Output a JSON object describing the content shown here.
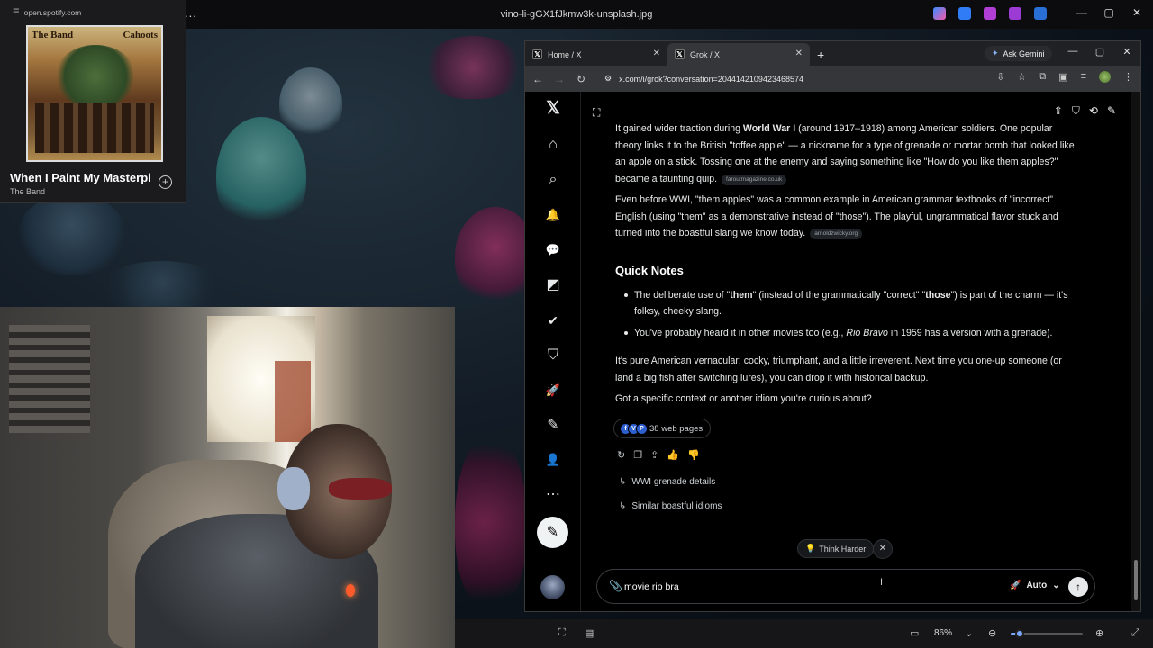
{
  "viewer": {
    "title": "vino-li-gGX1fJkmw3k-unsplash.jpg",
    "more_label": "...",
    "zoom_level": "86%",
    "zoom_slider_level_percent": 12
  },
  "spotify": {
    "url": "open.spotify.com",
    "album_cover_text_left": "The Band",
    "album_cover_text_right": "Cahoots",
    "track_title": "When I Paint My Masterpiece",
    "artist": "The Band",
    "add_label": "+"
  },
  "browser": {
    "tabs": [
      {
        "label": "Home / X",
        "active": false
      },
      {
        "label": "Grok / X",
        "active": true
      }
    ],
    "new_tab_label": "+",
    "ask_gemini_label": "Ask Gemini",
    "url": "x.com/i/grok?conversation=2044142109423468574"
  },
  "chat": {
    "para1": {
      "before": "It gained wider traction during ",
      "bold": "World War I",
      "after": " (around 1917–1918) among American soldiers. One popular theory links it to the British \"toffee apple\" — a nickname for a type of grenade or mortar bomb that looked like an apple on a stick. Tossing one at the enemy and saying something like \"How do you like them apples?\" became a taunting quip.",
      "source": "faroutmagazine.co.uk"
    },
    "para2": {
      "text": "Even before WWI, \"them apples\" was a common example in American grammar textbooks of \"incorrect\" English (using \"them\" as a demonstrative instead of \"those\"). The playful, ungrammatical flavor stuck and turned into the boastful slang we know today.",
      "source": "arnoldzwicky.org"
    },
    "heading": "Quick Notes",
    "bullet1": {
      "a": "The deliberate use of \"",
      "b1": "them",
      "c": "\" (instead of the grammatically \"correct\" \"",
      "b2": "those",
      "d": "\") is part of the charm — it's folksy, cheeky slang."
    },
    "bullet2": {
      "a": "You've probably heard it in other movies too (e.g., ",
      "italic": "Rio Bravo",
      "b": " in 1959 has a version with a grenade)."
    },
    "para3": "It's pure American vernacular: cocky, triumphant, and a little irreverent. Next time you one-up someone (or land a big fish after switching lures), you can drop it with historical backup.",
    "para4": "Got a specific context or another idiom you're curious about?",
    "web_pages_label": "38 web pages",
    "followups": [
      "WWI grenade details",
      "Similar boastful idioms"
    ],
    "think_harder_label": "Think Harder",
    "input_value": "movie rio bra",
    "mode_label": "Auto"
  },
  "icons": {
    "x_logo": "𝕏",
    "home": "⌂",
    "search": "⌕",
    "bell": "🔔",
    "message": "💬",
    "grok": "◩",
    "verified": "✔",
    "bookmark": "⛉",
    "rocket": "🚀",
    "edit": "✎",
    "profile": "👤",
    "more": "⋯",
    "compose": "✎"
  },
  "colors": {
    "x_background": "#000000",
    "text_primary": "#e7e9ea",
    "accent_slider": "#7aa7ff"
  }
}
